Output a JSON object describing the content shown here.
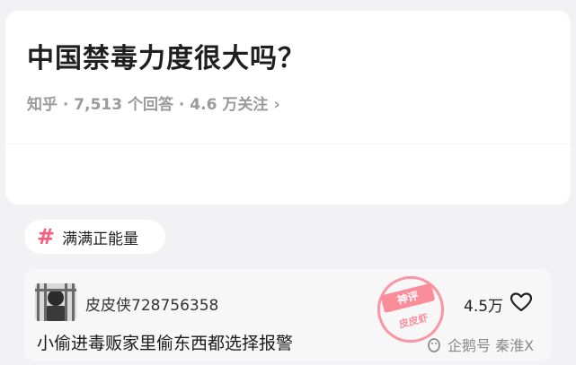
{
  "question": {
    "title": "中国禁毒力度很大吗？",
    "meta": "知乎 · 7,513 个回答 · 4.6 万关注"
  },
  "topic": {
    "icon": "hashtag-icon",
    "label": "满满正能量"
  },
  "answer": {
    "username": "皮皮侠728756358",
    "likes": "4.5万",
    "text": "小偷进毒贩家里偷东西都选择报警"
  },
  "stamp": {
    "top_text": "神评",
    "bottom_text": "皮皮虾"
  },
  "watermark": {
    "text": "企鹅号 秦淮X"
  },
  "colors": {
    "accent_pink": "#ff5a7a",
    "stamp_red": "#ff4d63"
  }
}
